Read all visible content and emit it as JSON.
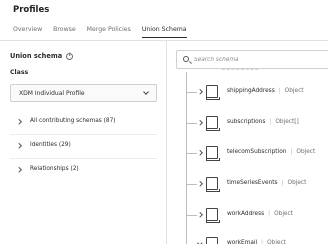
{
  "header": {
    "title": "Profiles",
    "tabs": [
      {
        "label": "Overview",
        "active": false
      },
      {
        "label": "Browse",
        "active": false
      },
      {
        "label": "Merge Policies",
        "active": false
      },
      {
        "label": "Union Schema",
        "active": true
      }
    ]
  },
  "left_panel": {
    "union_schema_title": "Union schema",
    "info_icon": "info-icon",
    "class_label": "Class",
    "class_select": {
      "value": "XDM Individual Profile"
    },
    "accordion": [
      {
        "label": "All contributing schemas (87)"
      },
      {
        "label": "Identities (29)"
      },
      {
        "label": "Relationships (2)"
      }
    ]
  },
  "right_panel": {
    "search": {
      "placeholder": "Search schema",
      "icon": "search-icon"
    },
    "tree": [
      {
        "name": "shippingAddress",
        "type": "Object",
        "expanded": false
      },
      {
        "name": "subscriptions",
        "type": "Object[]",
        "expanded": false
      },
      {
        "name": "telecomSubscription",
        "type": "Object",
        "expanded": false
      },
      {
        "name": "timeSeriesEvents",
        "type": "Object",
        "expanded": false
      },
      {
        "name": "workAddress",
        "type": "Object",
        "expanded": false
      },
      {
        "name": "workEmail",
        "type": "Object",
        "expanded": true
      }
    ]
  }
}
